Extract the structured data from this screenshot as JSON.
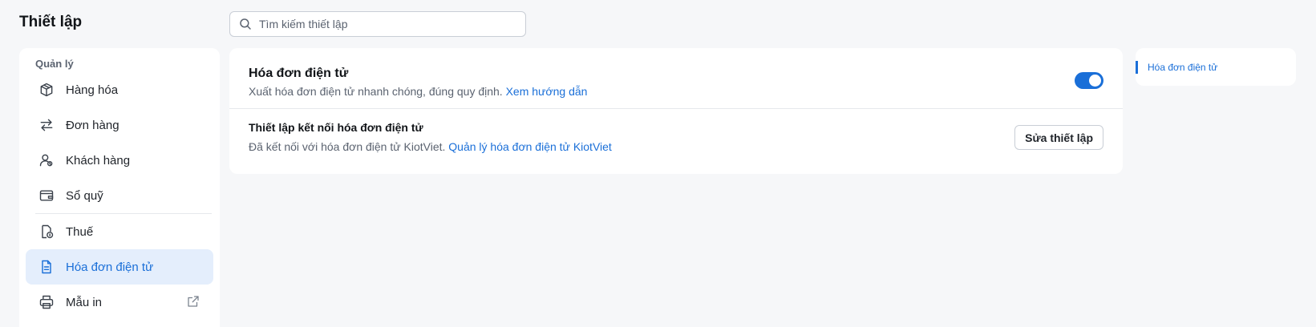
{
  "header": {
    "title": "Thiết lập",
    "search_placeholder": "Tìm kiếm thiết lập"
  },
  "sidebar": {
    "group_label": "Quản lý",
    "items": [
      {
        "label": "Hàng hóa",
        "icon": "box-icon"
      },
      {
        "label": "Đơn hàng",
        "icon": "swap-arrows-icon"
      },
      {
        "label": "Khách hàng",
        "icon": "customer-icon"
      },
      {
        "label": "Sổ quỹ",
        "icon": "wallet-icon"
      },
      {
        "label": "Thuế",
        "icon": "tax-document-icon"
      },
      {
        "label": "Hóa đơn điện tử",
        "icon": "invoice-document-icon",
        "active": true
      },
      {
        "label": "Mẫu in",
        "icon": "printer-icon",
        "external": "external-link-icon"
      }
    ]
  },
  "einvoice": {
    "title": "Hóa đơn điện tử",
    "description": "Xuất hóa đơn điện tử nhanh chóng, đúng quy định.",
    "guide_link": "Xem hướng dẫn",
    "enabled": true,
    "connection": {
      "title": "Thiết lập kết nối hóa đơn điện tử",
      "description": "Đã kết nối với hóa đơn điện tử KiotViet.",
      "manage_link": "Quản lý hóa đơn điện tử KiotViet",
      "edit_button": "Sửa thiết lập"
    }
  },
  "toc": {
    "items": [
      "Hóa đơn điện tử"
    ]
  },
  "colors": {
    "accent": "#1a6fd8",
    "active_bg": "#e4eefc",
    "page_bg": "#f6f7f9"
  }
}
